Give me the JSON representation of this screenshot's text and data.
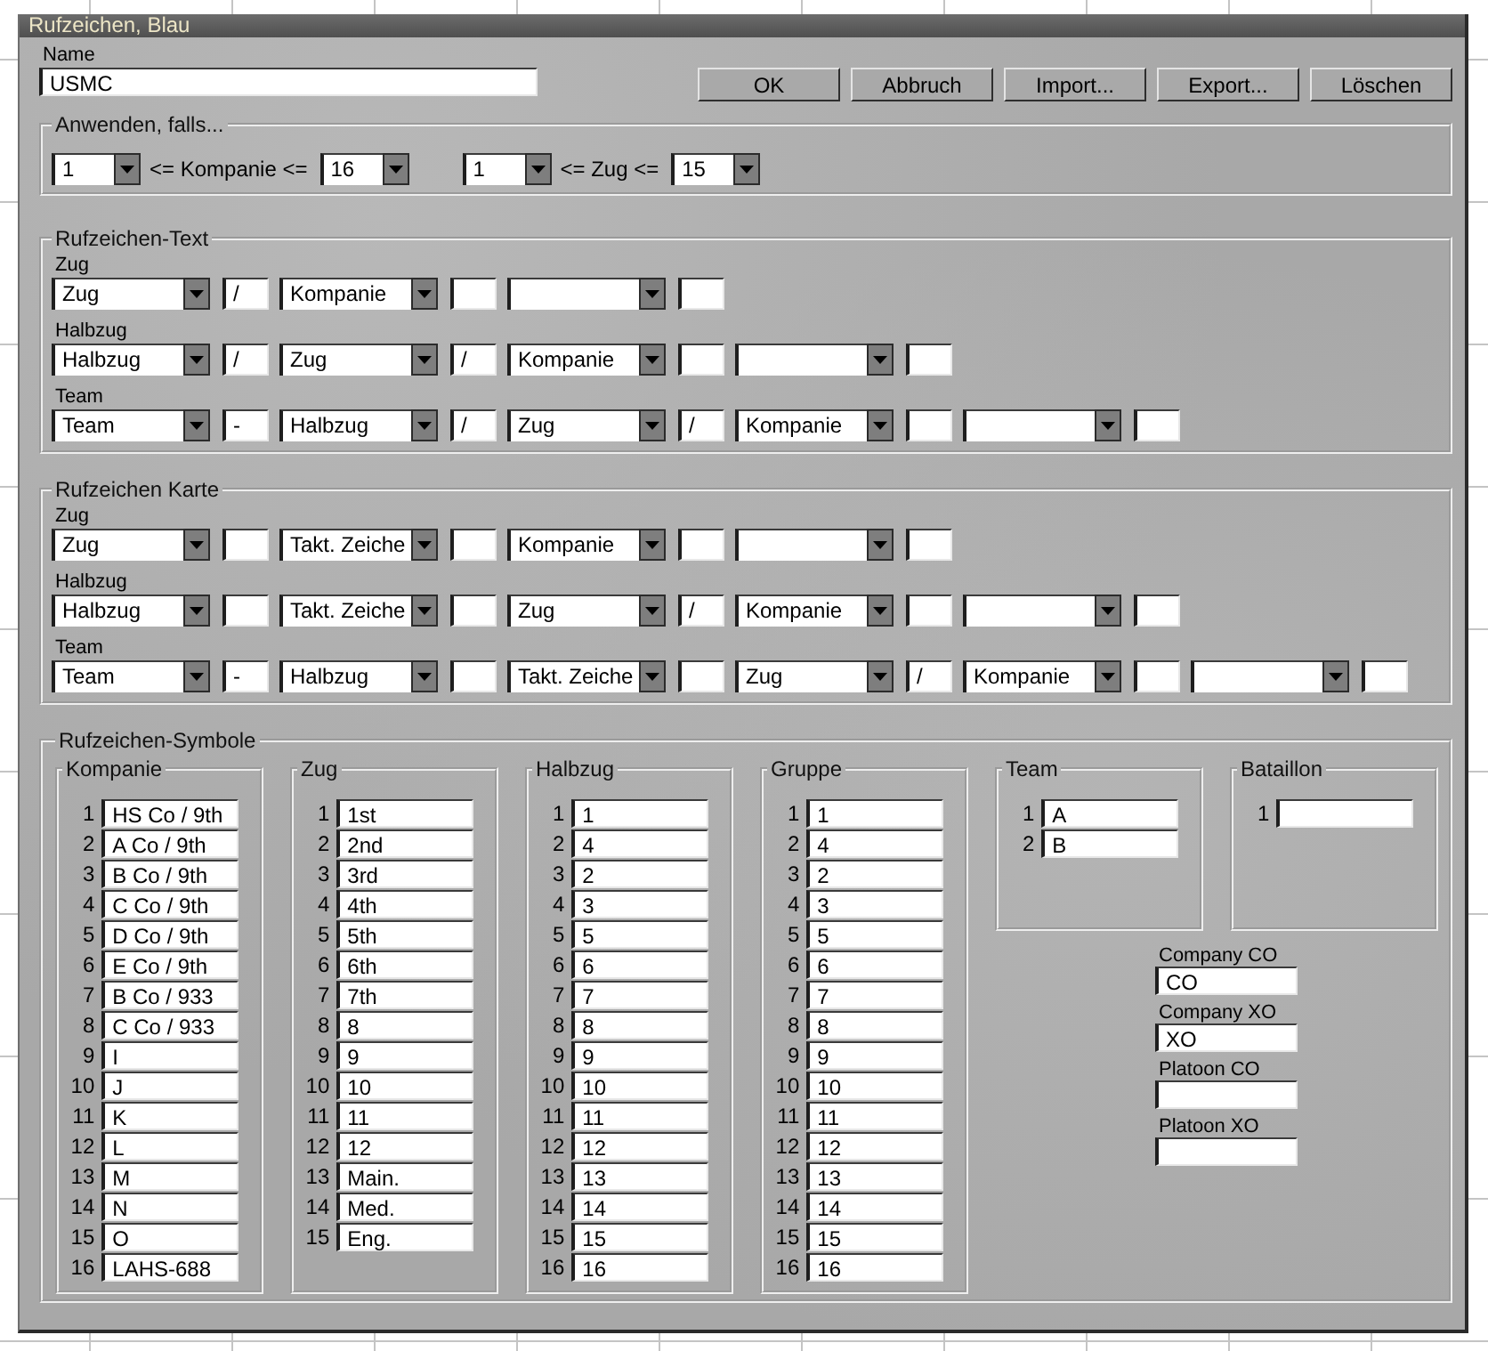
{
  "window": {
    "title": "Rufzeichen, Blau"
  },
  "name_field": {
    "label": "Name",
    "value": "USMC"
  },
  "buttons": [
    "OK",
    "Abbruch",
    "Import...",
    "Export...",
    "Löschen"
  ],
  "apply_if": {
    "title": "Anwenden, falls...",
    "ranges": [
      {
        "from": "1",
        "label": "<= Kompanie <=",
        "to": "16"
      },
      {
        "from": "1",
        "label": "<= Zug <=",
        "to": "15"
      }
    ]
  },
  "callsign_text": {
    "title": "Rufzeichen-Text",
    "rows": [
      {
        "label": "Zug",
        "parts": [
          {
            "kind": "dropdown",
            "value": "Zug"
          },
          {
            "kind": "field",
            "value": "/"
          },
          {
            "kind": "dropdown",
            "value": "Kompanie"
          },
          {
            "kind": "field"
          },
          {
            "kind": "dropdown"
          },
          {
            "kind": "field"
          }
        ]
      },
      {
        "label": "Halbzug",
        "parts": [
          {
            "kind": "dropdown",
            "value": "Halbzug"
          },
          {
            "kind": "field",
            "value": "/"
          },
          {
            "kind": "dropdown",
            "value": "Zug"
          },
          {
            "kind": "field",
            "value": "/"
          },
          {
            "kind": "dropdown",
            "value": "Kompanie"
          },
          {
            "kind": "field"
          },
          {
            "kind": "dropdown"
          },
          {
            "kind": "field"
          }
        ]
      },
      {
        "label": "Team",
        "parts": [
          {
            "kind": "dropdown",
            "value": "Team"
          },
          {
            "kind": "field",
            "value": "-"
          },
          {
            "kind": "dropdown",
            "value": "Halbzug"
          },
          {
            "kind": "field",
            "value": "/"
          },
          {
            "kind": "dropdown",
            "value": "Zug"
          },
          {
            "kind": "field",
            "value": "/"
          },
          {
            "kind": "dropdown",
            "value": "Kompanie"
          },
          {
            "kind": "field"
          },
          {
            "kind": "dropdown"
          },
          {
            "kind": "field"
          }
        ]
      }
    ]
  },
  "callsign_map": {
    "title": "Rufzeichen Karte",
    "rows": [
      {
        "label": "Zug",
        "parts": [
          {
            "kind": "dropdown",
            "value": "Zug"
          },
          {
            "kind": "field"
          },
          {
            "kind": "dropdown",
            "value": "Takt. Zeiche"
          },
          {
            "kind": "field"
          },
          {
            "kind": "dropdown",
            "value": "Kompanie"
          },
          {
            "kind": "field"
          },
          {
            "kind": "dropdown"
          },
          {
            "kind": "field"
          }
        ]
      },
      {
        "label": "Halbzug",
        "parts": [
          {
            "kind": "dropdown",
            "value": "Halbzug"
          },
          {
            "kind": "field"
          },
          {
            "kind": "dropdown",
            "value": "Takt. Zeiche"
          },
          {
            "kind": "field"
          },
          {
            "kind": "dropdown",
            "value": "Zug"
          },
          {
            "kind": "field",
            "value": "/"
          },
          {
            "kind": "dropdown",
            "value": "Kompanie"
          },
          {
            "kind": "field"
          },
          {
            "kind": "dropdown"
          },
          {
            "kind": "field"
          }
        ]
      },
      {
        "label": "Team",
        "parts": [
          {
            "kind": "dropdown",
            "value": "Team"
          },
          {
            "kind": "field",
            "value": "-"
          },
          {
            "kind": "dropdown",
            "value": "Halbzug"
          },
          {
            "kind": "field"
          },
          {
            "kind": "dropdown",
            "value": "Takt. Zeiche"
          },
          {
            "kind": "field"
          },
          {
            "kind": "dropdown",
            "value": "Zug"
          },
          {
            "kind": "field",
            "value": "/"
          },
          {
            "kind": "dropdown",
            "value": "Kompanie"
          },
          {
            "kind": "field"
          },
          {
            "kind": "dropdown"
          },
          {
            "kind": "field"
          }
        ]
      }
    ]
  },
  "callsign_symbols": {
    "title": "Rufzeichen-Symbole",
    "groups": [
      {
        "title": "Kompanie",
        "entries": [
          {
            "number": "1",
            "value": "HS Co / 9th"
          },
          {
            "number": "2",
            "value": "A Co / 9th"
          },
          {
            "number": "3",
            "value": "B Co / 9th"
          },
          {
            "number": "4",
            "value": "C Co / 9th"
          },
          {
            "number": "5",
            "value": "D Co / 9th"
          },
          {
            "number": "6",
            "value": "E Co / 9th"
          },
          {
            "number": "7",
            "value": "B Co / 933"
          },
          {
            "number": "8",
            "value": "C Co / 933"
          },
          {
            "number": "9",
            "value": "I"
          },
          {
            "number": "10",
            "value": "J"
          },
          {
            "number": "11",
            "value": "K"
          },
          {
            "number": "12",
            "value": "L"
          },
          {
            "number": "13",
            "value": "M"
          },
          {
            "number": "14",
            "value": "N"
          },
          {
            "number": "15",
            "value": "O"
          },
          {
            "number": "16",
            "value": "LAHS-688"
          }
        ]
      },
      {
        "title": "Zug",
        "entries": [
          {
            "number": "1",
            "value": "1st"
          },
          {
            "number": "2",
            "value": "2nd"
          },
          {
            "number": "3",
            "value": "3rd"
          },
          {
            "number": "4",
            "value": "4th"
          },
          {
            "number": "5",
            "value": "5th"
          },
          {
            "number": "6",
            "value": "6th"
          },
          {
            "number": "7",
            "value": "7th"
          },
          {
            "number": "8",
            "value": "8"
          },
          {
            "number": "9",
            "value": "9"
          },
          {
            "number": "10",
            "value": "10"
          },
          {
            "number": "11",
            "value": "11"
          },
          {
            "number": "12",
            "value": "12"
          },
          {
            "number": "13",
            "value": "Main."
          },
          {
            "number": "14",
            "value": "Med."
          },
          {
            "number": "15",
            "value": "Eng."
          }
        ]
      },
      {
        "title": "Halbzug",
        "entries": [
          {
            "number": "1",
            "value": "1"
          },
          {
            "number": "2",
            "value": "4"
          },
          {
            "number": "3",
            "value": "2"
          },
          {
            "number": "4",
            "value": "3"
          },
          {
            "number": "5",
            "value": "5"
          },
          {
            "number": "6",
            "value": "6"
          },
          {
            "number": "7",
            "value": "7"
          },
          {
            "number": "8",
            "value": "8"
          },
          {
            "number": "9",
            "value": "9"
          },
          {
            "number": "10",
            "value": "10"
          },
          {
            "number": "11",
            "value": "11"
          },
          {
            "number": "12",
            "value": "12"
          },
          {
            "number": "13",
            "value": "13"
          },
          {
            "number": "14",
            "value": "14"
          },
          {
            "number": "15",
            "value": "15"
          },
          {
            "number": "16",
            "value": "16"
          }
        ]
      },
      {
        "title": "Gruppe",
        "entries": [
          {
            "number": "1",
            "value": "1"
          },
          {
            "number": "2",
            "value": "4"
          },
          {
            "number": "3",
            "value": "2"
          },
          {
            "number": "4",
            "value": "3"
          },
          {
            "number": "5",
            "value": "5"
          },
          {
            "number": "6",
            "value": "6"
          },
          {
            "number": "7",
            "value": "7"
          },
          {
            "number": "8",
            "value": "8"
          },
          {
            "number": "9",
            "value": "9"
          },
          {
            "number": "10",
            "value": "10"
          },
          {
            "number": "11",
            "value": "11"
          },
          {
            "number": "12",
            "value": "12"
          },
          {
            "number": "13",
            "value": "13"
          },
          {
            "number": "14",
            "value": "14"
          },
          {
            "number": "15",
            "value": "15"
          },
          {
            "number": "16",
            "value": "16"
          }
        ]
      },
      {
        "title": "Team",
        "entries": [
          {
            "number": "1",
            "value": "A"
          },
          {
            "number": "2",
            "value": "B"
          }
        ]
      },
      {
        "title": "Bataillon",
        "entries": [
          {
            "number": "1"
          }
        ]
      }
    ],
    "officers": [
      {
        "label": "Company CO",
        "value": "CO"
      },
      {
        "label": "Company XO",
        "value": "XO"
      },
      {
        "label": "Platoon CO"
      },
      {
        "label": "Platoon XO"
      }
    ]
  }
}
